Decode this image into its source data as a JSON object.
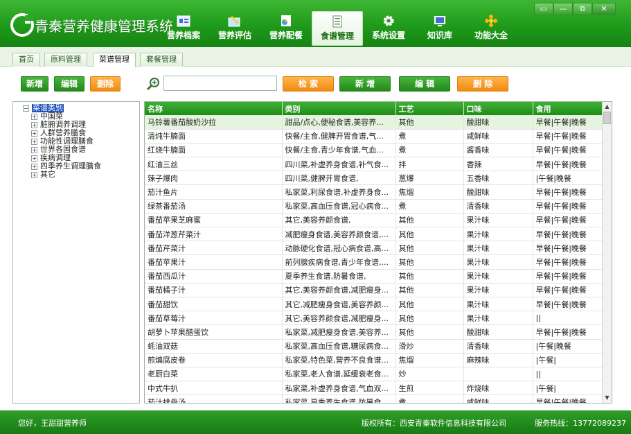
{
  "app": {
    "title": "青秦营养健康管理系统"
  },
  "nav": [
    {
      "label": "营养档案",
      "icon": "profile-icon"
    },
    {
      "label": "营养评估",
      "icon": "assessment-icon"
    },
    {
      "label": "营养配餐",
      "icon": "meal-plan-icon"
    },
    {
      "label": "食谱管理",
      "icon": "recipe-icon",
      "active": true
    },
    {
      "label": "系统设置",
      "icon": "gear-icon"
    },
    {
      "label": "知识库",
      "icon": "knowledge-icon"
    },
    {
      "label": "功能大全",
      "icon": "features-icon"
    }
  ],
  "window_controls": [
    "▭",
    "—",
    "⧉",
    "✕"
  ],
  "tabs": [
    {
      "label": "首页"
    },
    {
      "label": "原料管理"
    },
    {
      "label": "菜谱管理",
      "active": true
    },
    {
      "label": "套餐管理"
    }
  ],
  "toolbar": {
    "add": "新增",
    "edit": "编辑",
    "delete": "删除",
    "search_btn": "检 索",
    "add2": "新 增",
    "edit2": "编 辑",
    "delete2": "删 除",
    "search_value": ""
  },
  "tree": {
    "root": "菜谱类别",
    "items": [
      "中国菜",
      "脏腑调养调理",
      "人群营养膳食",
      "功能性调理膳食",
      "世界各国食谱",
      "疾病调理",
      "四季养生调理膳食",
      "其它"
    ]
  },
  "table": {
    "columns": [
      "名称",
      "类别",
      "工艺",
      "口味",
      "食用"
    ],
    "rows": [
      [
        "马铃薯番茄酸奶沙拉",
        "甜品/点心,便秘食谱,美容养...",
        "其他",
        "酸甜味",
        "早餐|午餐|晚餐"
      ],
      [
        "清炖牛腩面",
        "快餐/主食,健脾开胃食谱,气...",
        "煮",
        "咸鲜味",
        "早餐|午餐|晚餐"
      ],
      [
        "红烧牛腩面",
        "快餐/主食,青少年食谱,气血...",
        "煮",
        "酱香味",
        "早餐|午餐|晚餐"
      ],
      [
        "红油三丝",
        "四川菜,补虚养身食谱,补气食...",
        "拌",
        "香辣",
        "早餐|午餐|晚餐"
      ],
      [
        "辣子爆肉",
        "四川菜,健脾开胃食谱,",
        "葱爆",
        "五香味",
        "|午餐|晚餐"
      ],
      [
        "茄汁鱼片",
        "私家菜,利尿食谱,补虚养身食...",
        "焦熘",
        "酸甜味",
        "早餐|午餐|晚餐"
      ],
      [
        "绿茶番茄汤",
        "私家菜,高血压食谱,冠心病食...",
        "煮",
        "清香味",
        "早餐|午餐|晚餐"
      ],
      [
        "番茄苹果芝麻蜜",
        "其它,美容养颜食谱,",
        "其他",
        "果汁味",
        "早餐|午餐|晚餐"
      ],
      [
        "番茄洋葱芹菜汁",
        "减肥瘦身食谱,美容养颜食谱,...",
        "其他",
        "果汁味",
        "早餐|午餐|晚餐"
      ],
      [
        "番茄芹菜汁",
        "动脉硬化食谱,冠心病食谱,高...",
        "其他",
        "果汁味",
        "早餐|午餐|晚餐"
      ],
      [
        "番茄苹果汁",
        "前列腺疾病食谱,青少年食谱,...",
        "其他",
        "果汁味",
        "早餐|午餐|晚餐"
      ],
      [
        "番茄西瓜汁",
        "夏季养生食谱,防暑食谱,",
        "其他",
        "果汁味",
        "早餐|午餐|晚餐"
      ],
      [
        "番茄橘子汁",
        "其它,美容养颜食谱,减肥瘦身...",
        "其他",
        "果汁味",
        "早餐|午餐|晚餐"
      ],
      [
        "番茄甜饮",
        "其它,减肥瘦身食谱,美容养颜...",
        "其他",
        "果汁味",
        "早餐|午餐|晚餐"
      ],
      [
        "番茄草莓汁",
        "其它,美容养颜食谱,减肥瘦身...",
        "其他",
        "果汁味",
        "||"
      ],
      [
        "胡萝卜苹果醋蛋饮",
        "私家菜,减肥瘦身食谱,美容养...",
        "其他",
        "酸甜味",
        "早餐|午餐|晚餐"
      ],
      [
        "蚝油双菇",
        "私家菜,高血压食谱,糖尿病食...",
        "滑炒",
        "清香味",
        "|午餐|晚餐"
      ],
      [
        "煎煸腐皮卷",
        "私家菜,特色菜,营养不良食谱...",
        "焦熘",
        "麻辣味",
        "|午餐|"
      ],
      [
        "老厨白菜",
        "私家菜,老人食谱,延缓衰老食...",
        "炒",
        "",
        "||"
      ],
      [
        "中式牛扒",
        "私家菜,补虚养身食谱,气血双...",
        "生煎",
        "炸烧味",
        "|午餐|"
      ],
      [
        "茄汁排骨汤",
        "私家菜,夏季养生食谱,防暑食...",
        "煮",
        "咸鲜味",
        "早餐|午餐|晚餐"
      ]
    ]
  },
  "footer": {
    "greeting": "您好，王甜甜营养师",
    "copyright": "版权所有：西安青秦软件信息科技有限公司",
    "hotline": "服务热线：13772089237"
  }
}
